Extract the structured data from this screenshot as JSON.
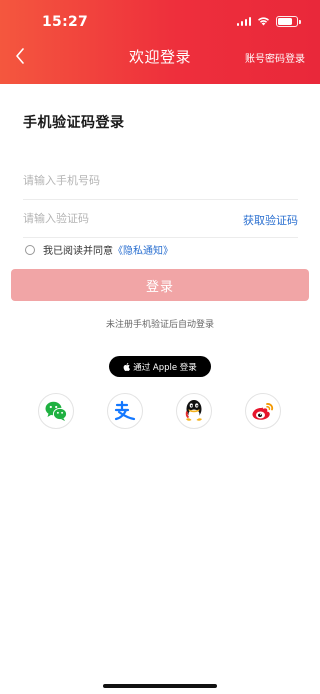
{
  "status_bar": {
    "time": "15:27"
  },
  "nav": {
    "title": "欢迎登录",
    "right_link": "账号密码登录"
  },
  "form": {
    "title": "手机验证码登录",
    "phone_placeholder": "请输入手机号码",
    "code_placeholder": "请输入验证码",
    "get_code_label": "获取验证码",
    "agree_text": "我已阅读并同意",
    "privacy_link": "《隐私通知》",
    "login_label": "登录",
    "hint": "未注册手机验证后自动登录"
  },
  "third_party": {
    "apple_label": "通过 Apple 登录",
    "icons": [
      "wechat-icon",
      "alipay-icon",
      "qq-icon",
      "weibo-icon"
    ]
  },
  "colors": {
    "header_start": "#f4573e",
    "header_end": "#e9283a",
    "link_blue": "#2a6fd0",
    "login_disabled": "#f1a5a6"
  }
}
